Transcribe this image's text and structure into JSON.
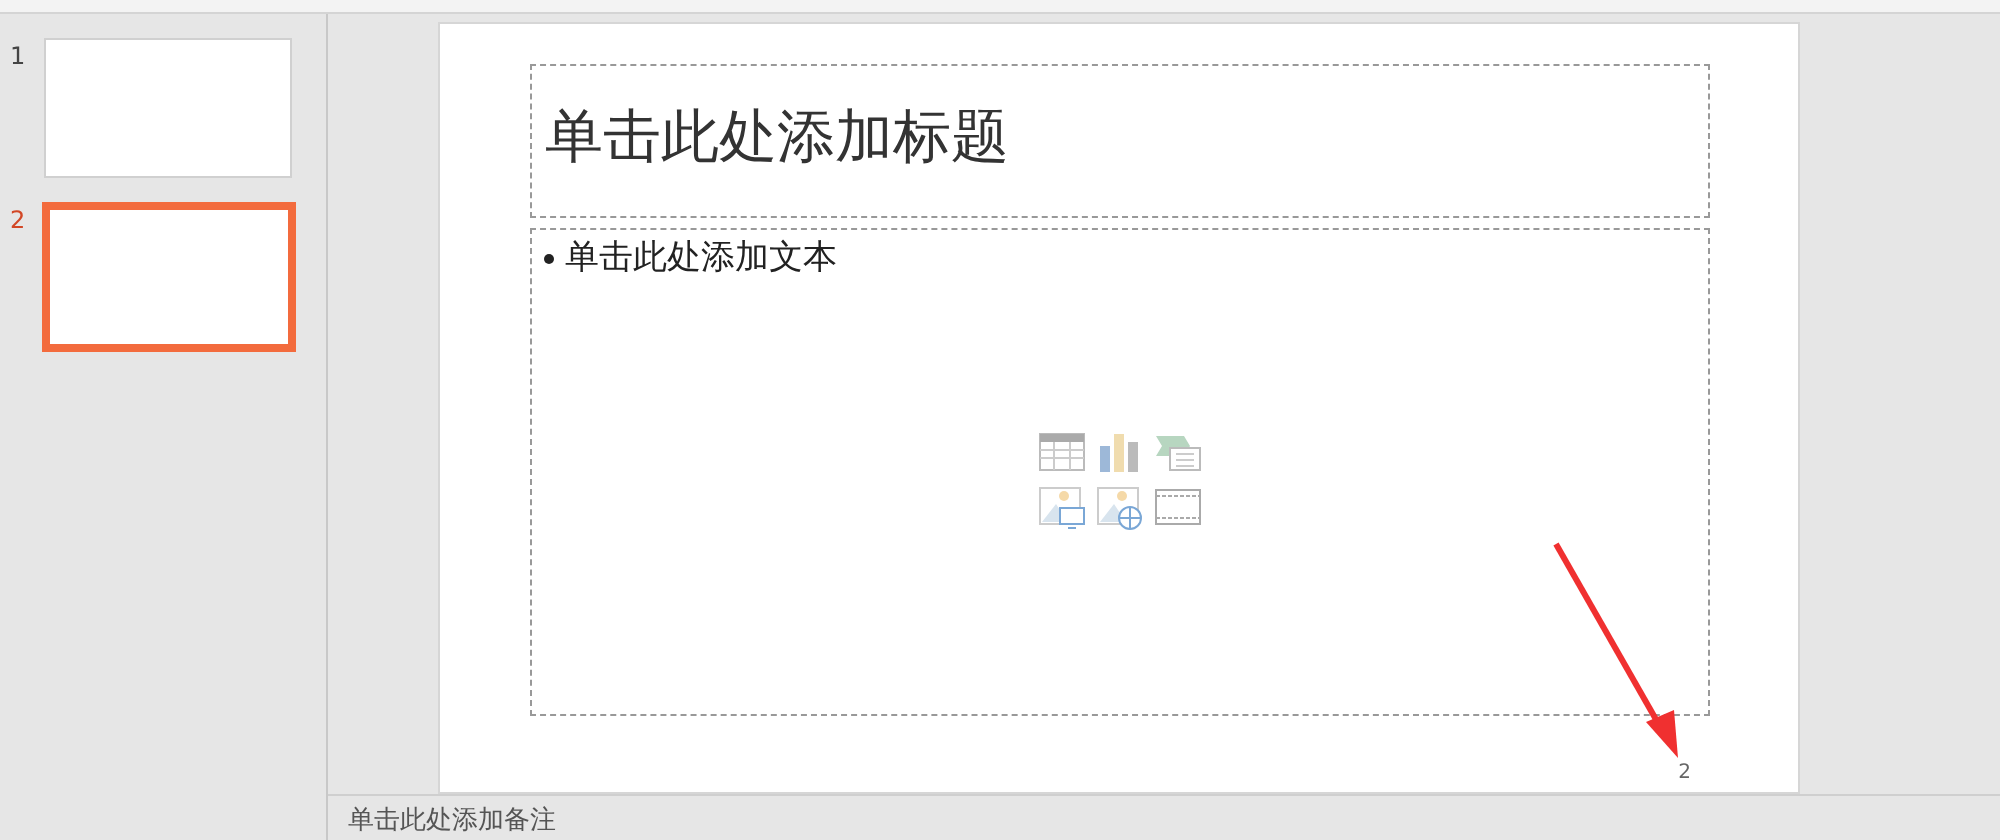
{
  "slides": [
    {
      "number": "1",
      "selected": false
    },
    {
      "number": "2",
      "selected": true
    }
  ],
  "current_slide": {
    "title_placeholder": "单击此处添加标题",
    "body_placeholder": "单击此处添加文本",
    "slide_number": "2"
  },
  "notes": {
    "placeholder": "单击此处添加备注"
  }
}
